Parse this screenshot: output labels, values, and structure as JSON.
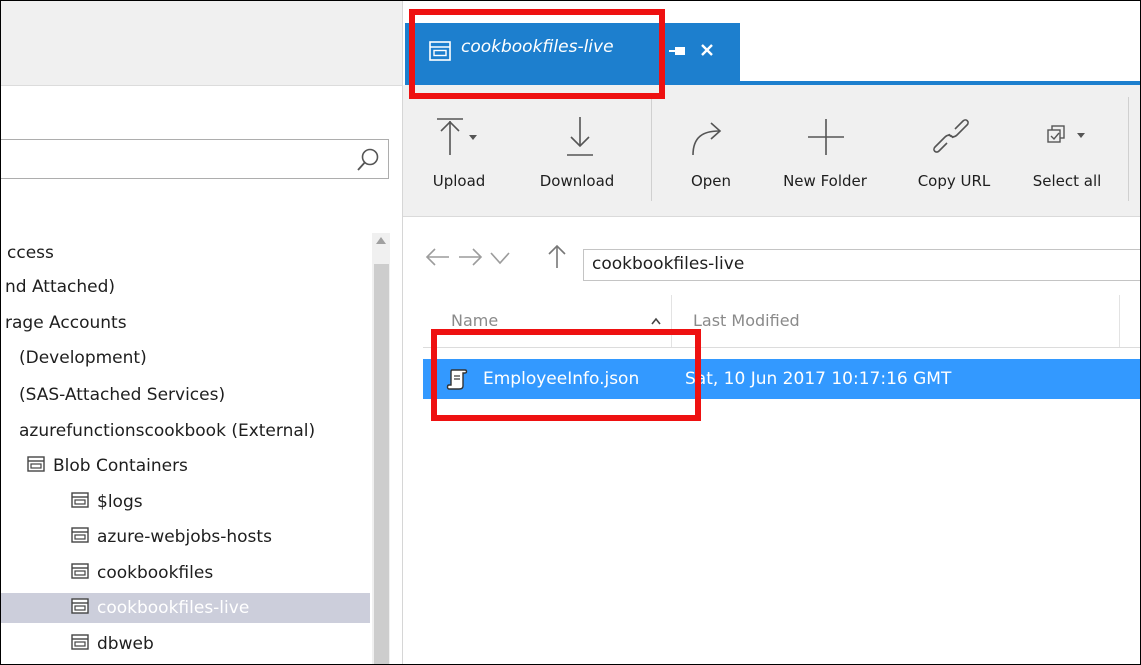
{
  "colors": {
    "accent": "#1d7fce",
    "selection": "#3399ff",
    "tree_selection": "#cccedb",
    "highlight_box": "#ee1111"
  },
  "tab": {
    "title": "cookbookfiles-live",
    "icon": "container-icon",
    "close_icon": "close-icon",
    "pin_icon": "pin-icon"
  },
  "toolbar": {
    "buttons": [
      {
        "label": "Upload",
        "icon": "upload-icon"
      },
      {
        "label": "Download",
        "icon": "download-icon"
      },
      {
        "label": "Open",
        "icon": "open-icon"
      },
      {
        "label": "New Folder",
        "icon": "new-folder-icon"
      },
      {
        "label": "Copy URL",
        "icon": "link-icon"
      },
      {
        "label": "Select all",
        "icon": "select-all-icon"
      }
    ]
  },
  "address_bar": {
    "path": "cookbookfiles-live"
  },
  "columns": {
    "name": "Name",
    "last_modified": "Last Modified"
  },
  "files": [
    {
      "name": "EmployeeInfo.json",
      "last_modified": "Sat, 10 Jun 2017 10:17:16 GMT"
    }
  ],
  "tree": {
    "items": [
      {
        "label": "ccess"
      },
      {
        "label": "nd Attached)"
      },
      {
        "label": "rage Accounts"
      },
      {
        "label": "(Development)"
      },
      {
        "label": "(SAS-Attached Services)"
      },
      {
        "label": "azurefunctionscookbook (External)"
      },
      {
        "label": "Blob Containers"
      },
      {
        "label": "$logs"
      },
      {
        "label": "azure-webjobs-hosts"
      },
      {
        "label": "cookbookfiles"
      },
      {
        "label": "cookbookfiles-live"
      },
      {
        "label": "dbweb"
      }
    ]
  }
}
